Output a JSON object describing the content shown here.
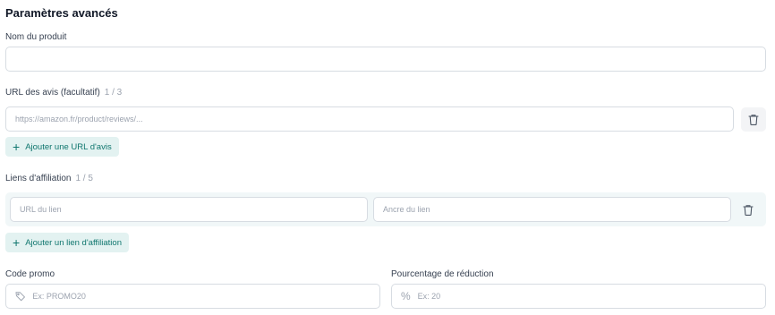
{
  "section": {
    "title": "Paramètres avancés"
  },
  "product_name": {
    "label": "Nom du produit",
    "value": ""
  },
  "review_urls": {
    "label": "URL des avis (facultatif)",
    "counter": "1 / 3",
    "placeholder": "https://amazon.fr/product/reviews/...",
    "add_label": "Ajouter une URL d'avis"
  },
  "affiliate_links": {
    "label": "Liens d'affiliation",
    "counter": "1 / 5",
    "url_placeholder": "URL du lien",
    "anchor_placeholder": "Ancre du lien",
    "add_label": "Ajouter un lien d'affiliation"
  },
  "promo_code": {
    "label": "Code promo",
    "placeholder": "Ex: PROMO20",
    "icon": "tag-icon"
  },
  "discount": {
    "label": "Pourcentage de réduction",
    "placeholder": "Ex: 20",
    "icon": "percent-icon"
  },
  "colors": {
    "accent": "#0f766e",
    "accent_bg": "#e3f2f1",
    "row_bg": "#f1f7f8"
  }
}
